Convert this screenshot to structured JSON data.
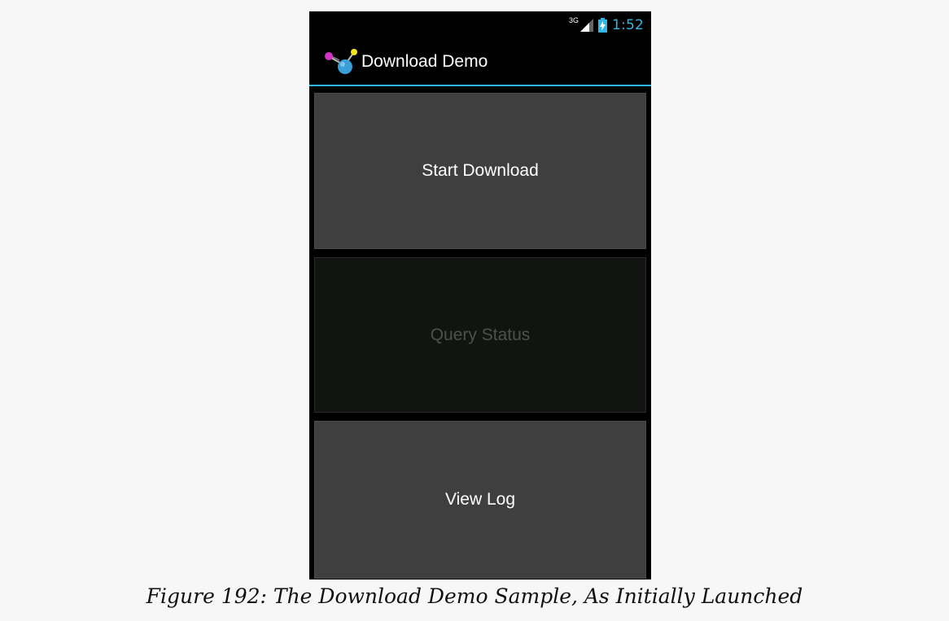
{
  "status_bar": {
    "network_type": "3G",
    "time": "1:52",
    "icons": [
      "signal-icon",
      "battery-charging-icon"
    ],
    "accent_color": "#33b5e5"
  },
  "action_bar": {
    "app_icon": "download-demo-app-icon",
    "title": "Download Demo"
  },
  "buttons": {
    "start_download": "Start Download",
    "query_status": "Query Status",
    "view_log": "View Log"
  },
  "caption": "Figure 192: The Download Demo Sample, As Initially Launched"
}
